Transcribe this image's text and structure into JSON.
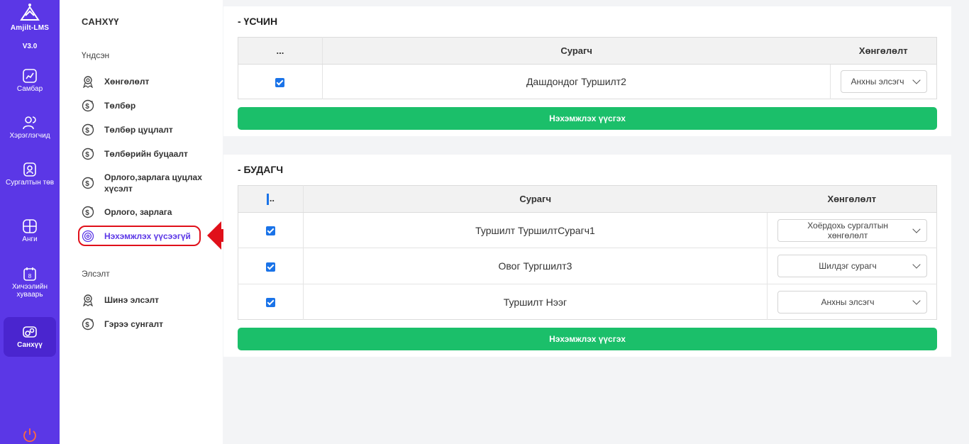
{
  "app": {
    "name": "Amjilt-LMS",
    "version": "V3.0"
  },
  "rail": [
    {
      "label": "Самбар",
      "icon": "chart-icon"
    },
    {
      "label": "Хэрэглэгчид",
      "icon": "users-icon"
    },
    {
      "label": "Сургалтын төв",
      "icon": "center-icon"
    },
    {
      "label": "Анги",
      "icon": "grid-icon"
    },
    {
      "label": "Хичээлийн хуваарь",
      "icon": "calendar-icon"
    },
    {
      "label": "Санхүү",
      "icon": "finance-icon"
    }
  ],
  "rail_calendar_day": "8",
  "sidebar": {
    "title": "САНХҮҮ",
    "group1": "Үндсэн",
    "items1": [
      {
        "label": "Хөнгөлөлт"
      },
      {
        "label": "Төлбөр"
      },
      {
        "label": "Төлбөр цуцлалт"
      },
      {
        "label": "Төлбөрийн буцаалт"
      },
      {
        "label": "Орлого,зарлага цуцлах хүсэлт"
      },
      {
        "label": "Орлого, зарлага"
      },
      {
        "label": "Нэхэмжлэх үүсээгүй"
      }
    ],
    "group2": "Элсэлт",
    "items2": [
      {
        "label": "Шинэ элсэлт"
      },
      {
        "label": "Гэрээ сунгалт"
      }
    ]
  },
  "section1": {
    "title": "- ҮСЧИН",
    "columns": [
      "...",
      "Сурагч",
      "Хөнгөлөлт"
    ],
    "rows": [
      {
        "checked": true,
        "student": "Дашдондог Туршилт2",
        "discount": "Анхны элсэгч"
      }
    ],
    "button": "Нэхэмжлэх үүсгэх"
  },
  "section2": {
    "title": "- БУДАГЧ",
    "columns": [
      "..",
      "Сурагч",
      "Хөнгөлөлт"
    ],
    "rows": [
      {
        "checked": true,
        "student": "Туршилт ТуршилтСурагч1",
        "discount": "Хоёрдохь сургалтын хөнгөлөлт"
      },
      {
        "checked": true,
        "student": "Овог Тургшилт3",
        "discount": "Шилдэг сурагч"
      },
      {
        "checked": true,
        "student": "Туршилт Нээг",
        "discount": "Анхны элсэгч"
      }
    ],
    "button": "Нэхэмжлэх үүсгэх"
  },
  "colors": {
    "brand": "#5b37e6",
    "primary_button": "#1bbf6a",
    "highlight": "#e0101a"
  }
}
